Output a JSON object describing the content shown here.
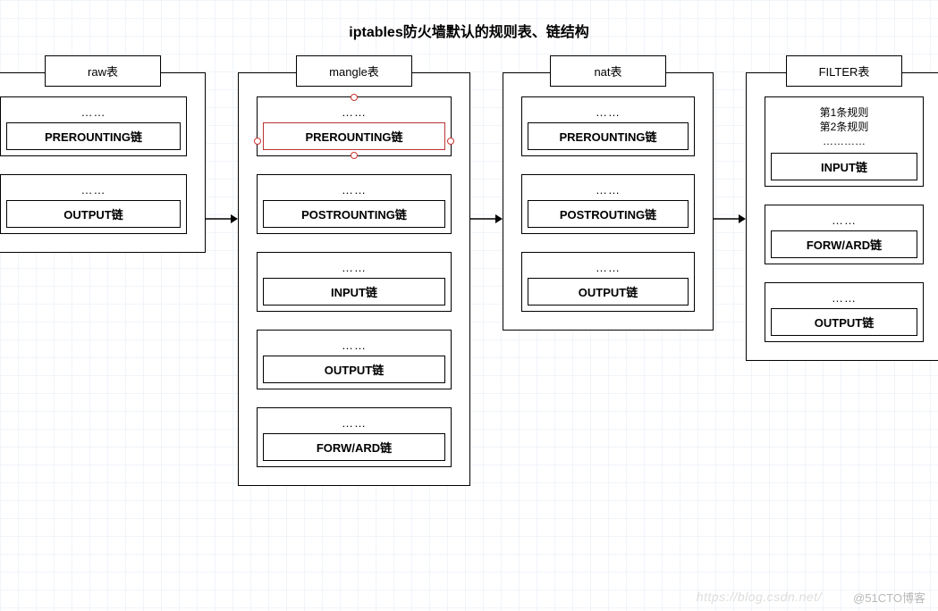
{
  "title": "iptables防火墙默认的规则表、链结构",
  "dots": "……",
  "tables": [
    {
      "id": "raw",
      "label": "raw表",
      "chains": [
        {
          "name": "PREROUNTING链",
          "top": "……"
        },
        {
          "name": "OUTPUT链",
          "top": "……"
        }
      ]
    },
    {
      "id": "mangle",
      "label": "mangle表",
      "chains": [
        {
          "name": "PREROUNTING链",
          "top": "……",
          "selected": true
        },
        {
          "name": "POSTROUNTING链",
          "top": "……"
        },
        {
          "name": "INPUT链",
          "top": "……"
        },
        {
          "name": "OUTPUT链",
          "top": "……"
        },
        {
          "name": "FORW/ARD链",
          "top": "……"
        }
      ]
    },
    {
      "id": "nat",
      "label": "nat表",
      "chains": [
        {
          "name": "PREROUNTING链",
          "top": "……"
        },
        {
          "name": "POSTROUTING链",
          "top": "……"
        },
        {
          "name": "OUTPUT链",
          "top": "……"
        }
      ]
    },
    {
      "id": "filter",
      "label": "FILTER表",
      "chains": [
        {
          "name": "INPUT链",
          "rules": [
            "第1条规则",
            "第2条规则",
            "…………"
          ]
        },
        {
          "name": "FORW/ARD链",
          "top": "……"
        },
        {
          "name": "OUTPUT链",
          "top": "……"
        }
      ]
    }
  ],
  "watermark1": "https://blog.csdn.net/",
  "watermark2": "@51CTO博客"
}
